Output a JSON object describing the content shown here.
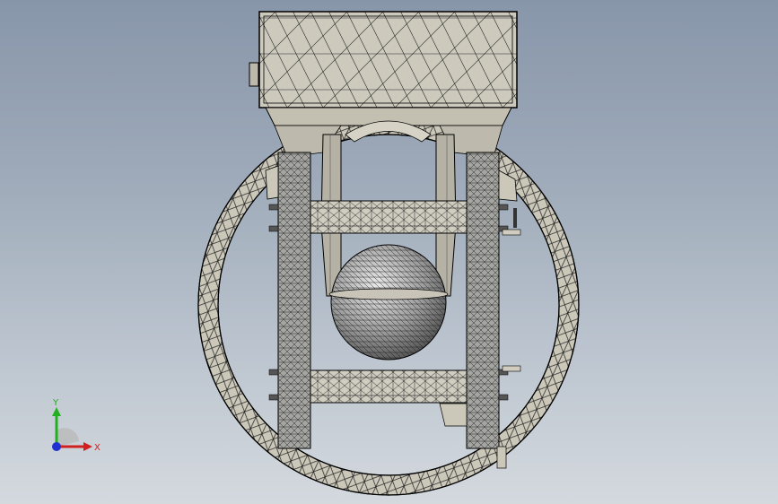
{
  "viewport": {
    "view_name": "front-view",
    "background_top": "#8896aa",
    "background_bottom": "#d4d9de"
  },
  "model": {
    "name": "spherical-float-assembly",
    "body_color": "#c9c6b8",
    "edge_color": "#000000",
    "ring_color": "#cbc8ba",
    "column_color": "#9a9a9a",
    "sphere_color": "#9c9c9c"
  },
  "triad": {
    "x_label": "X",
    "y_label": "Y",
    "x_color": "#d02020",
    "y_color": "#20b020",
    "z_color": "#2030d0"
  }
}
